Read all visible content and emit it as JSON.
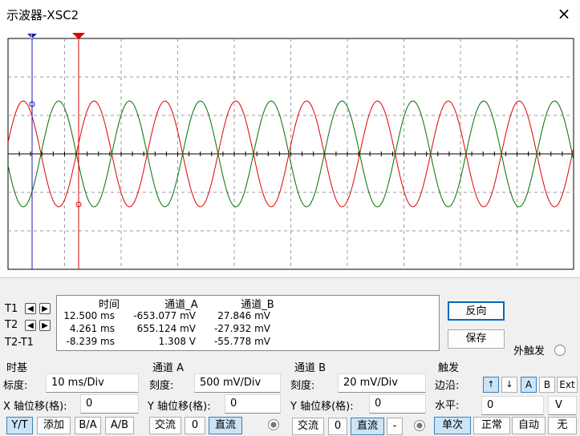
{
  "window": {
    "title": "示波器-XSC2",
    "close_icon": "×"
  },
  "scope": {
    "background": "#ffffff",
    "channel_a_color": "#e00000",
    "channel_b_color": "#007000",
    "cursor_t1_color": "#1a1ab4",
    "cursor_t2_color": "#e00000",
    "grid": "dashed"
  },
  "cursors": {
    "t1_label": "T1",
    "t2_label": "T2",
    "diff_label": "T2-T1",
    "left_arrow": "◀",
    "right_arrow": "▶"
  },
  "measurements": {
    "headers": [
      "时间",
      "通道_A",
      "通道_B"
    ],
    "rows": [
      [
        "12.500 ms",
        "-653.077 mV",
        "27.846 mV"
      ],
      [
        "4.261 ms",
        "655.124 mV",
        "-27.932 mV"
      ],
      [
        "-8.239 ms",
        "1.308 V",
        "-55.778 mV"
      ]
    ]
  },
  "actions": {
    "reverse": "反向",
    "save": "保存",
    "ext_trigger": "外触发"
  },
  "timebase": {
    "title": "时基",
    "scale_label": "标度:",
    "scale_value": "10 ms/Div",
    "xpos_label": "X 轴位移(格):",
    "xpos_value": "0",
    "modes": [
      "Y/T",
      "添加",
      "B/A",
      "A/B"
    ]
  },
  "channel_a": {
    "title": "通道 A",
    "scale_label": "刻度:",
    "scale_value": "500 mV/Div",
    "ypos_label": "Y 轴位移(格):",
    "ypos_value": "0",
    "coupling": [
      "交流",
      "0",
      "直流"
    ]
  },
  "channel_b": {
    "title": "通道 B",
    "scale_label": "刻度:",
    "scale_value": "20 mV/Div",
    "ypos_label": "Y 轴位移(格):",
    "ypos_value": "0",
    "coupling": [
      "交流",
      "0",
      "直流",
      "-"
    ]
  },
  "trigger": {
    "title": "触发",
    "edge_label": "边沿:",
    "edge_rising_icon": "↑",
    "edge_falling_icon": "↓",
    "sources": [
      "A",
      "B",
      "Ext"
    ],
    "level_label": "水平:",
    "level_value": "0",
    "level_unit": "V",
    "modes": [
      "单次",
      "正常",
      "自动",
      "无"
    ]
  }
}
